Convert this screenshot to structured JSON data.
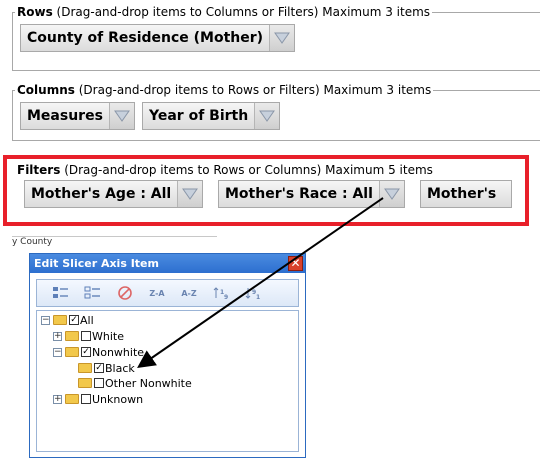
{
  "rows": {
    "title": "Rows",
    "hint": "(Drag-and-drop items to Columns or Filters) Maximum 3 items",
    "items": [
      {
        "label": "County of Residence (Mother)"
      }
    ]
  },
  "columns": {
    "title": "Columns",
    "hint": "(Drag-and-drop items to Rows or Filters) Maximum 3 items",
    "items": [
      {
        "label": "Measures"
      },
      {
        "label": "Year of Birth"
      }
    ]
  },
  "filters": {
    "title": "Filters",
    "hint": "(Drag-and-drop items to Rows or Columns) Maximum 5 items",
    "items": [
      {
        "label": "Mother's Age : All"
      },
      {
        "label": "Mother's Race : All"
      },
      {
        "label": "Mother's"
      }
    ]
  },
  "background": {
    "strip_text": "y County"
  },
  "dialog": {
    "title": "Edit Slicer Axis Item",
    "close_glyph": "✕",
    "toolbar": {
      "sort_za": "Z-A",
      "sort_az": "A-Z"
    },
    "tree": {
      "all": "All",
      "white": "White",
      "nonwhite": "Nonwhite",
      "black": "Black",
      "other_nonwhite": "Other Nonwhite",
      "unknown": "Unknown"
    }
  },
  "colors": {
    "highlight": "#e8202a",
    "dialog_title": "#2d6fcf"
  }
}
